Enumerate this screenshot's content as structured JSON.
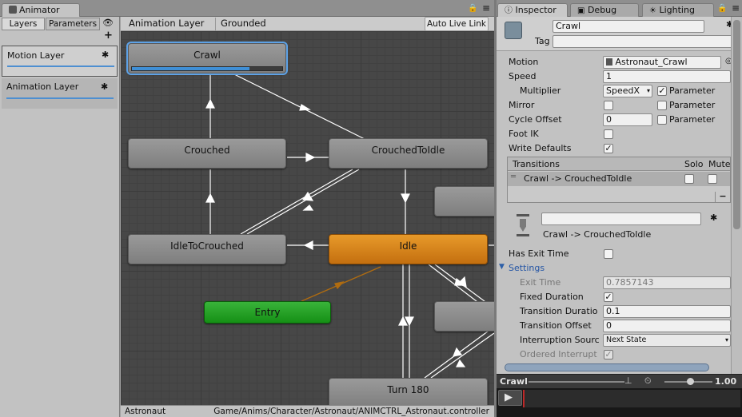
{
  "animator": {
    "window_title": "Animator",
    "tabs": [
      "Layers",
      "Parameters"
    ],
    "add_label": "+",
    "layers": [
      {
        "name": "Motion Layer"
      },
      {
        "name": "Animation Layer"
      }
    ],
    "breadcrumb": [
      "Animation Layer",
      "Grounded"
    ],
    "auto_live_link": "Auto Live Link",
    "states": {
      "crawl": "Crawl",
      "crouched": "Crouched",
      "crouched_to_idle": "CrouchedToIdle",
      "idle_to_crouched": "IdleToCrouched",
      "idle": "Idle",
      "entry": "Entry",
      "turn180": "Turn 180"
    },
    "crawl_progress": 0.78,
    "status": {
      "object": "Astronaut",
      "path": "Game/Anims/Character/Astronaut/ANIMCTRL_Astronaut.controller"
    }
  },
  "inspector": {
    "tabs": [
      "Inspector",
      "Debug",
      "Lighting"
    ],
    "state_name": "Crawl",
    "tag_label": "Tag",
    "tag_value": "",
    "props": {
      "motion_label": "Motion",
      "motion_value": "Astronaut_Crawl",
      "speed_label": "Speed",
      "speed_value": "1",
      "multiplier_label": "Multiplier",
      "multiplier_value": "SpeedX",
      "parameter_label": "Parameter",
      "mirror_label": "Mirror",
      "cycle_offset_label": "Cycle Offset",
      "cycle_offset_value": "0",
      "foot_ik_label": "Foot IK",
      "write_defaults_label": "Write Defaults"
    },
    "transitions": {
      "header": "Transitions",
      "solo": "Solo",
      "mute": "Mute",
      "items": [
        "Crawl -> CrouchedToIdle"
      ],
      "remove": "−"
    },
    "transition": {
      "name_value": "",
      "title": "Crawl -> CrouchedToIdle",
      "has_exit_time_label": "Has Exit Time",
      "settings_label": "Settings",
      "exit_time_label": "Exit Time",
      "exit_time_value": "0.7857143",
      "fixed_duration_label": "Fixed Duration",
      "transition_duration_label": "Transition Duratio",
      "transition_duration_value": "0.1",
      "transition_offset_label": "Transition Offset",
      "transition_offset_value": "0",
      "interruption_label": "Interruption Sourc",
      "interruption_value": "Next State",
      "ordered_label": "Ordered Interrupt"
    },
    "preview": {
      "clip": "Crawl",
      "speed": "1.00"
    }
  }
}
